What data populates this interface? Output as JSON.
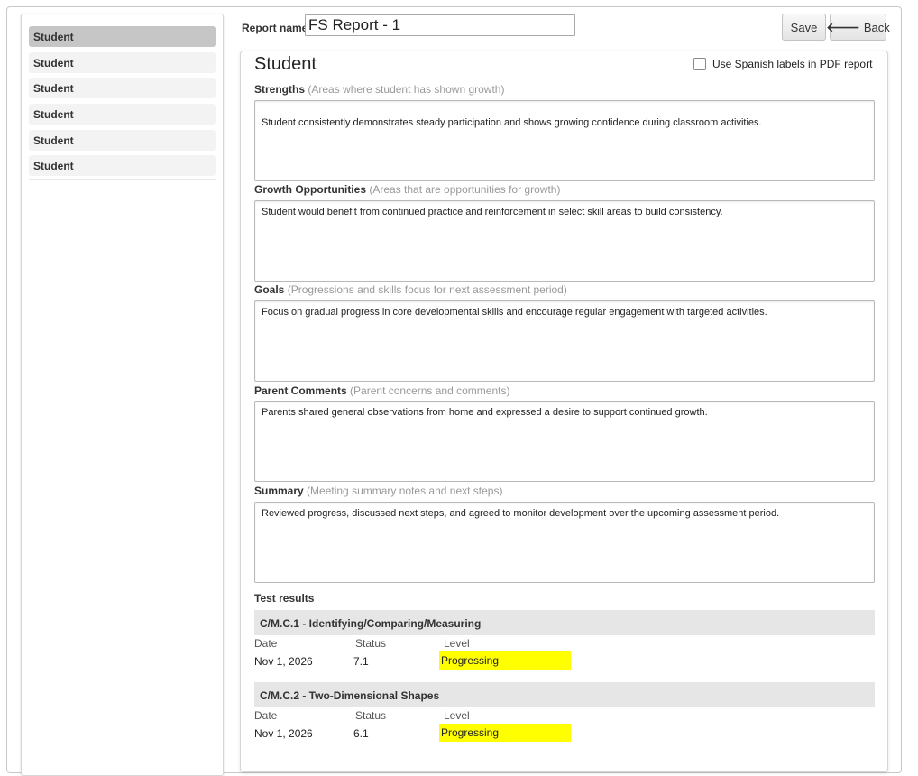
{
  "sidebar": {
    "items": [
      {
        "label": "Student"
      },
      {
        "label": "Student"
      },
      {
        "label": "Student"
      },
      {
        "label": "Student"
      },
      {
        "label": "Student"
      },
      {
        "label": "Student"
      }
    ]
  },
  "header": {
    "report_name_label": "Report name",
    "report_name_value": "FS Report - 1",
    "save_label": "Save",
    "back_label": "Back"
  },
  "panel": {
    "title": "Student",
    "spanish_checkbox_label": "Use Spanish labels in PDF report",
    "spanish_checked": false,
    "sections": [
      {
        "label": "Strengths",
        "hint": "(Areas where student has shown growth)",
        "text": "Student consistently demonstrates steady participation and shows growing confidence during classroom activities."
      },
      {
        "label": "Growth Opportunities",
        "hint": "(Areas that are opportunities for growth)",
        "text": "Student would benefit from continued practice and reinforcement in select skill areas to build consistency."
      },
      {
        "label": "Goals",
        "hint": "(Progressions and skills focus for next assessment period)",
        "text": "Focus on gradual progress in core developmental skills and encourage regular engagement with targeted activities."
      },
      {
        "label": "Parent Comments",
        "hint": "(Parent concerns and comments)",
        "text": "Parents shared general observations from home and expressed a desire to support continued growth."
      },
      {
        "label": "Summary",
        "hint": "(Meeting summary notes and next steps)",
        "text": "Reviewed progress, discussed next steps, and agreed to monitor development over the upcoming assessment period."
      }
    ]
  },
  "test_results": {
    "heading": "Test results",
    "columns": {
      "date": "Date",
      "status": "Status",
      "level": "Level"
    },
    "tests": [
      {
        "name": "C/M.C.1 - Identifying/Comparing/Measuring",
        "date": "Nov 1, 2026",
        "status": "7.1",
        "level": "Progressing"
      },
      {
        "name": "C/M.C.2 - Two-Dimensional Shapes",
        "date": "Nov 1, 2026",
        "status": "6.1",
        "level": "Progressing"
      }
    ]
  },
  "colors": {
    "level_highlight": "#ffff00",
    "active_sidebar": "#c6c6c6",
    "test_bar": "#e6e6e6"
  }
}
